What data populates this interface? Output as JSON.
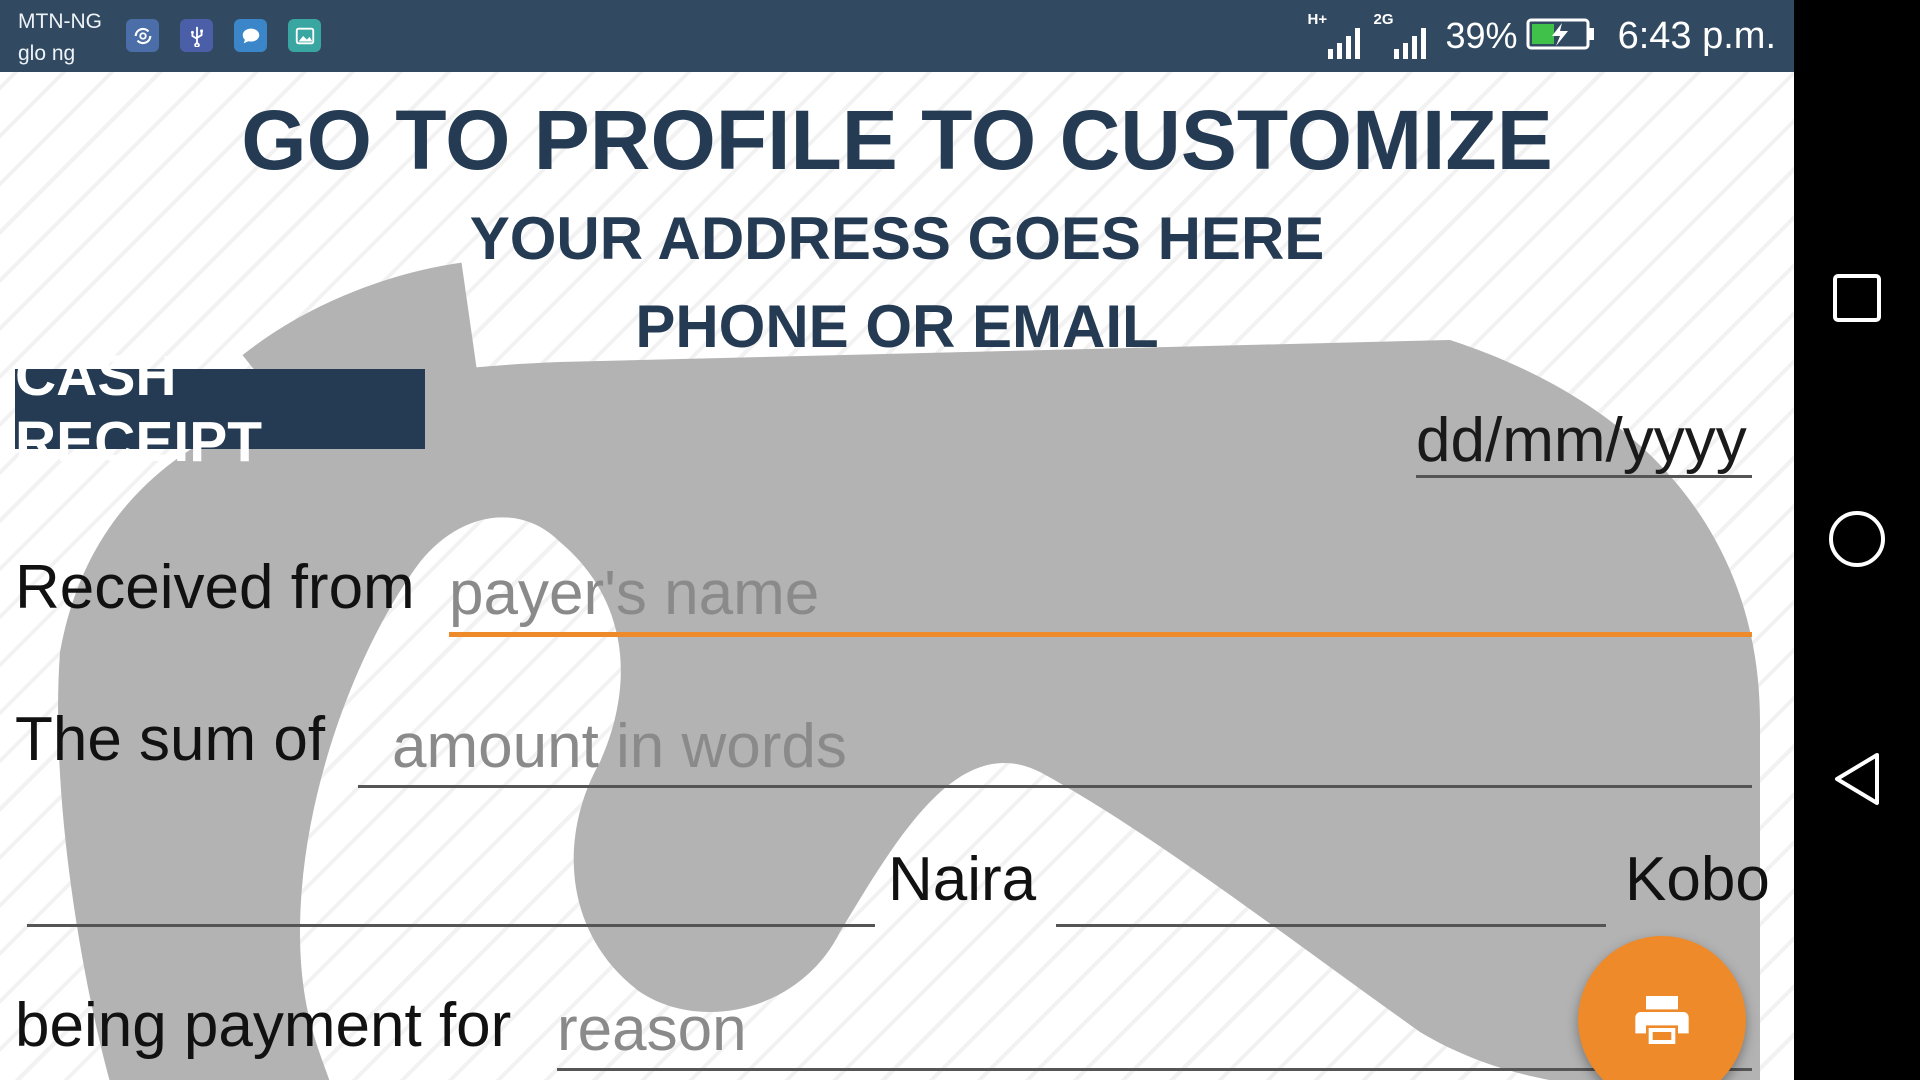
{
  "status_bar": {
    "carrier_1": "MTN-NG",
    "carrier_2": "glo ng",
    "network_1": "H+",
    "network_2": "2G",
    "battery": "39%",
    "time": "6:43 p.m.",
    "notification_icons": [
      "sync-icon",
      "usb-icon",
      "message-icon",
      "image-icon"
    ]
  },
  "receipt": {
    "company_name": "GO TO PROFILE TO CUSTOMIZE",
    "company_address": "YOUR ADDRESS GOES HERE",
    "company_contact": "PHONE OR EMAIL",
    "badge": "CASH RECEIPT",
    "date_value": "dd/mm/yyyy",
    "received_from_label": "Received from",
    "payer_placeholder": "payer's name",
    "sum_label": "The sum of",
    "amount_placeholder": "amount in words",
    "naira_label": "Naira",
    "kobo_label": "Kobo",
    "payment_label": "being payment for",
    "reason_placeholder": "reason"
  },
  "fab": {
    "icon": "print-icon"
  },
  "navigation": {
    "icons": [
      "recents-icon",
      "home-icon",
      "back-icon"
    ]
  },
  "colors": {
    "status_bar": "#324a61",
    "heading": "#243b53",
    "accent": "#ee8a2a",
    "watermark": "#b3b3b3"
  }
}
